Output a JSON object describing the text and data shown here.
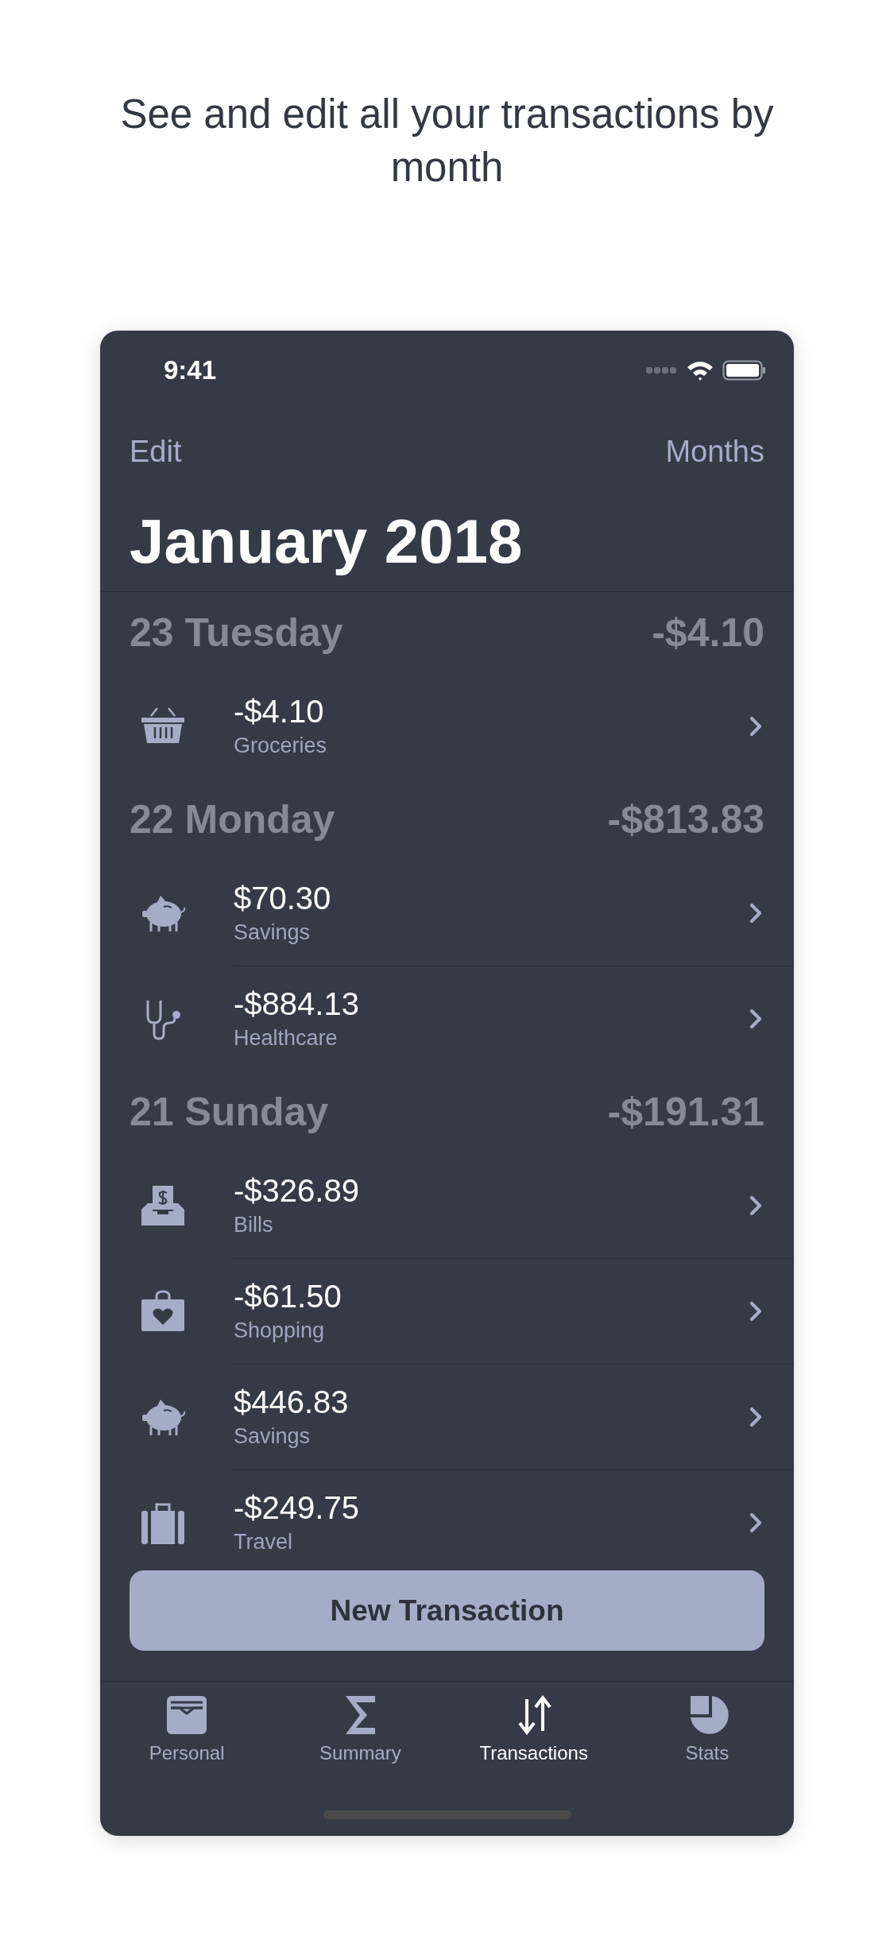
{
  "headline": "See and edit all your transactions by month",
  "status_bar": {
    "time": "9:41"
  },
  "nav": {
    "left": "Edit",
    "right": "Months"
  },
  "title": "January 2018",
  "days": [
    {
      "label": "23 Tuesday",
      "total": "-$4.10",
      "transactions": [
        {
          "amount": "-$4.10",
          "category": "Groceries",
          "kind": "basket"
        }
      ]
    },
    {
      "label": "22 Monday",
      "total": "-$813.83",
      "transactions": [
        {
          "amount": "$70.30",
          "category": "Savings",
          "kind": "piggy"
        },
        {
          "amount": "-$884.13",
          "category": "Healthcare",
          "kind": "stethoscope"
        }
      ]
    },
    {
      "label": "21 Sunday",
      "total": "-$191.31",
      "transactions": [
        {
          "amount": "-$326.89",
          "category": "Bills",
          "kind": "inbox"
        },
        {
          "amount": "-$61.50",
          "category": "Shopping",
          "kind": "bag"
        },
        {
          "amount": "$446.83",
          "category": "Savings",
          "kind": "piggy"
        },
        {
          "amount": "-$249.75",
          "category": "Travel",
          "kind": "suitcase"
        }
      ]
    }
  ],
  "new_button": "New Transaction",
  "tabs": [
    {
      "label": "Personal",
      "kind": "wallet",
      "selected": false
    },
    {
      "label": "Summary",
      "kind": "sigma",
      "selected": false
    },
    {
      "label": "Transactions",
      "kind": "arrows",
      "selected": true
    },
    {
      "label": "Stats",
      "kind": "pie",
      "selected": false
    }
  ]
}
